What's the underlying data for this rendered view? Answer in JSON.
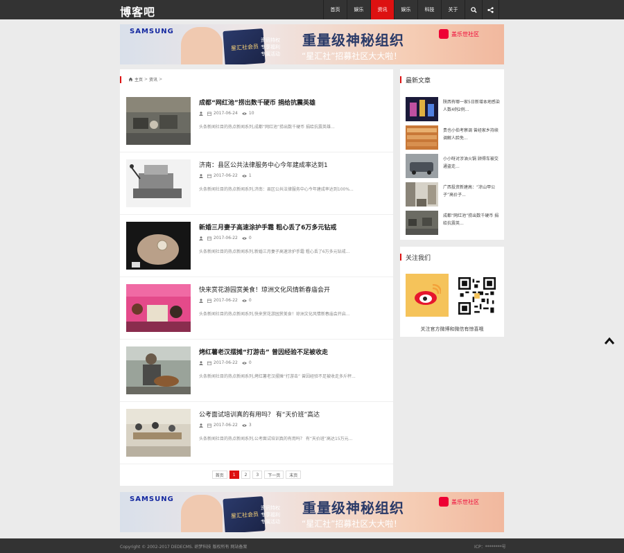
{
  "site": {
    "logo": "博客吧"
  },
  "nav": {
    "items": [
      {
        "label": "首页",
        "active": false
      },
      {
        "label": "娱乐",
        "active": false
      },
      {
        "label": "资讯",
        "active": true
      },
      {
        "label": "娱乐",
        "active": false
      },
      {
        "label": "科技",
        "active": false
      },
      {
        "label": "关于",
        "active": false
      }
    ],
    "icons": [
      "search-icon",
      "share-icon"
    ],
    "accent_color": "#dd1111"
  },
  "banner": {
    "brand": "SAMSUNG",
    "card_label": "星汇社会员",
    "promo_lines": [
      "资讯特权",
      "专享福利",
      "专属活动"
    ],
    "headline": "重量级神秘组织",
    "subline": "“星汇社”招募社区大大啦！",
    "community": "盖乐世社区"
  },
  "breadcrumb": {
    "home": "主页",
    "current": "资讯",
    "sep": ">"
  },
  "posts": [
    {
      "title": "成都“网红池”捞出数千硬币 捐给抗震英雄",
      "bold": true,
      "date": "2017-06-24",
      "views": "10",
      "summary": "头条新闻社目的热点新闻系列,成都“网红池”捞出数千硬币 捐给抗震英雄..."
    },
    {
      "title": "济南：县区公共法律服务中心今年建成率达到1",
      "bold": false,
      "date": "2017-06-22",
      "views": "1",
      "summary": "头条新闻社目的热点新闻系列,济南：县区公共法律服务中心今年建成率达到100%..."
    },
    {
      "title": "新婚三月妻子高速涂护手霜 粗心丢了6万多元钻戒",
      "bold": true,
      "date": "2017-06-22",
      "views": "0",
      "summary": "头条新闻社目的热点新闻系列,新婚三月妻子高速涂护手霜 粗心丢了6万多元钻戒..."
    },
    {
      "title": "快来赏花游园赏美食！琼洲文化风情新春庙会开",
      "bold": false,
      "date": "2017-06-22",
      "views": "0",
      "summary": "头条新闻社目的热点新闻系列,快来赏花游园赏美食！琼洲文化风情新春庙会开启..."
    },
    {
      "title": "烤红薯老汉摆摊“打游击” 曾因经验不足被收走",
      "bold": true,
      "date": "2017-06-22",
      "views": "0",
      "summary": "头条新闻社目的热点新闻系列,烤红薯老汉摆摊“打游击” 曾因经验不足被收走多斤秤..."
    },
    {
      "title": "公考面试培训真的有用吗？ 有“天价班”高达",
      "bold": false,
      "date": "2017-06-22",
      "views": "3",
      "summary": "头条新闻社目的热点新闻系列,公考面试培训真的有用吗？ 有“天价班”高达15万元..."
    }
  ],
  "pager": {
    "first": "首页",
    "pages": [
      "1",
      "2",
      "3"
    ],
    "current": "1",
    "next": "下一页",
    "last": "末页"
  },
  "sidebar": {
    "latest_title": "最新文章",
    "latest": [
      {
        "text": "陕西有哪一家5日新增本地感染人数4例2例..."
      },
      {
        "text": "贵也小伯考察调 曾经家乡持续调解人脸免..."
      },
      {
        "text": "小小呀对涉油火锅 顾得车被交通盗走..."
      },
      {
        "text": "广西投资新建高：“凉山甲公子”高价子..."
      },
      {
        "text": "成都“网红池”捞出数千硬币 捐给抗震英..."
      }
    ],
    "follow_title": "关注我们",
    "follow_note": "关注官方微博和微信有惊喜哦"
  },
  "footer": {
    "copyright": "Copyright © 2002-2017 DEDECMS. 织梦科技 版权所有 网站备案",
    "icp": "ICP：********号"
  }
}
